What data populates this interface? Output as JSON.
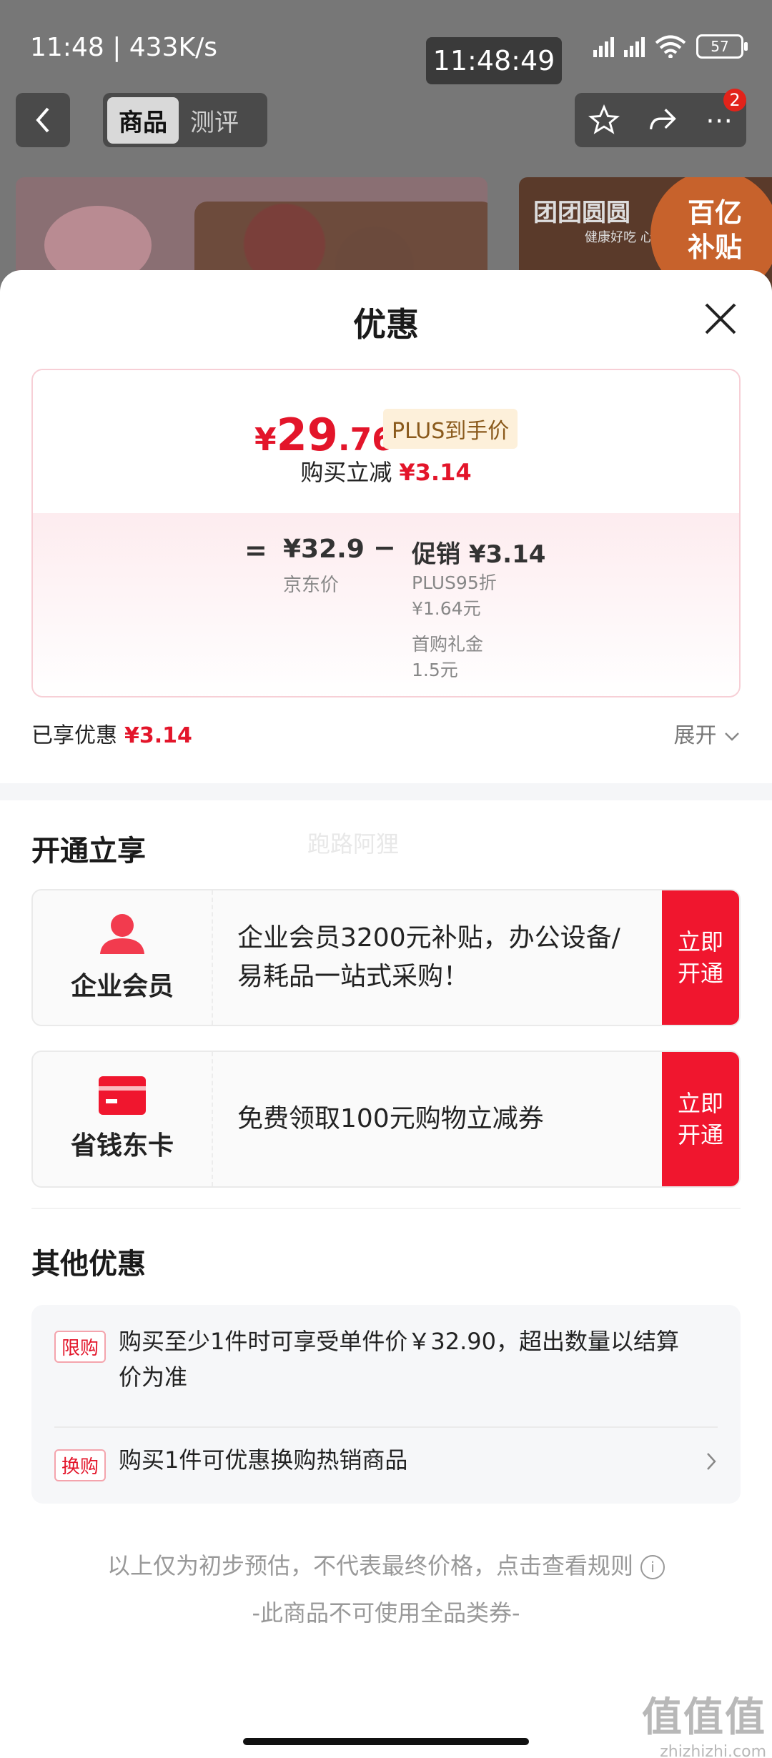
{
  "status_bar": {
    "time_speed": "11:48 | 433K/s",
    "clock_overlay": "11:48:49",
    "battery": "57"
  },
  "nav": {
    "tabs": [
      {
        "label": "商品",
        "active": true
      },
      {
        "label": "测评",
        "active": false
      }
    ],
    "more_badge": "2"
  },
  "banner": {
    "right_title": "团团圆圆",
    "right_sub": "健康好吃 心",
    "subsidy_line1": "百亿",
    "subsidy_line2": "补贴"
  },
  "sheet": {
    "title": "优惠",
    "final_price": {
      "currency": "¥",
      "integer": "29",
      "decimal": ".76"
    },
    "plus_tag": "PLUS到手价",
    "saving_label": "购买立减",
    "saving_value": "¥3.14",
    "equals": "=",
    "jd_price": "¥32.9",
    "jd_price_label": "京东价",
    "minus": "−",
    "promo_total": "促销 ¥3.14",
    "promo_items": [
      {
        "line1": "PLUS95折",
        "line2": "¥1.64元"
      },
      {
        "line1": "首购礼金",
        "line2": "1.5元"
      }
    ],
    "enjoyed_label": "已享优惠",
    "enjoyed_value": "¥3.14",
    "expand_label": "展开"
  },
  "open_section": {
    "title": "开通立享",
    "watermark": "跑路阿狸",
    "cards": [
      {
        "name": "企业会员",
        "desc": "企业会员3200元补贴，办公设备/易耗品一站式采购！",
        "button_line1": "立即",
        "button_line2": "开通",
        "icon": "person-icon"
      },
      {
        "name": "省钱东卡",
        "desc": "免费领取100元购物立减券",
        "button_line1": "立即",
        "button_line2": "开通",
        "icon": "card-icon"
      }
    ]
  },
  "other_section": {
    "title": "其他优惠",
    "items": [
      {
        "tag": "限购",
        "text": "购买至少1件时可享受单件价￥32.90，超出数量以结算价为准"
      },
      {
        "tag": "换购",
        "text": "购买1件可优惠换购热销商品"
      }
    ]
  },
  "footer": {
    "note": "以上仅为初步预估，不代表最终价格，点击查看规则",
    "note2": "-此商品不可使用全品类券-",
    "info_icon_glyph": "i"
  },
  "site_mark": {
    "big": "值值值",
    "small": "zhizhizhi.com"
  },
  "colors": {
    "accent_red": "#e3152a",
    "button_red": "#f0162e"
  }
}
